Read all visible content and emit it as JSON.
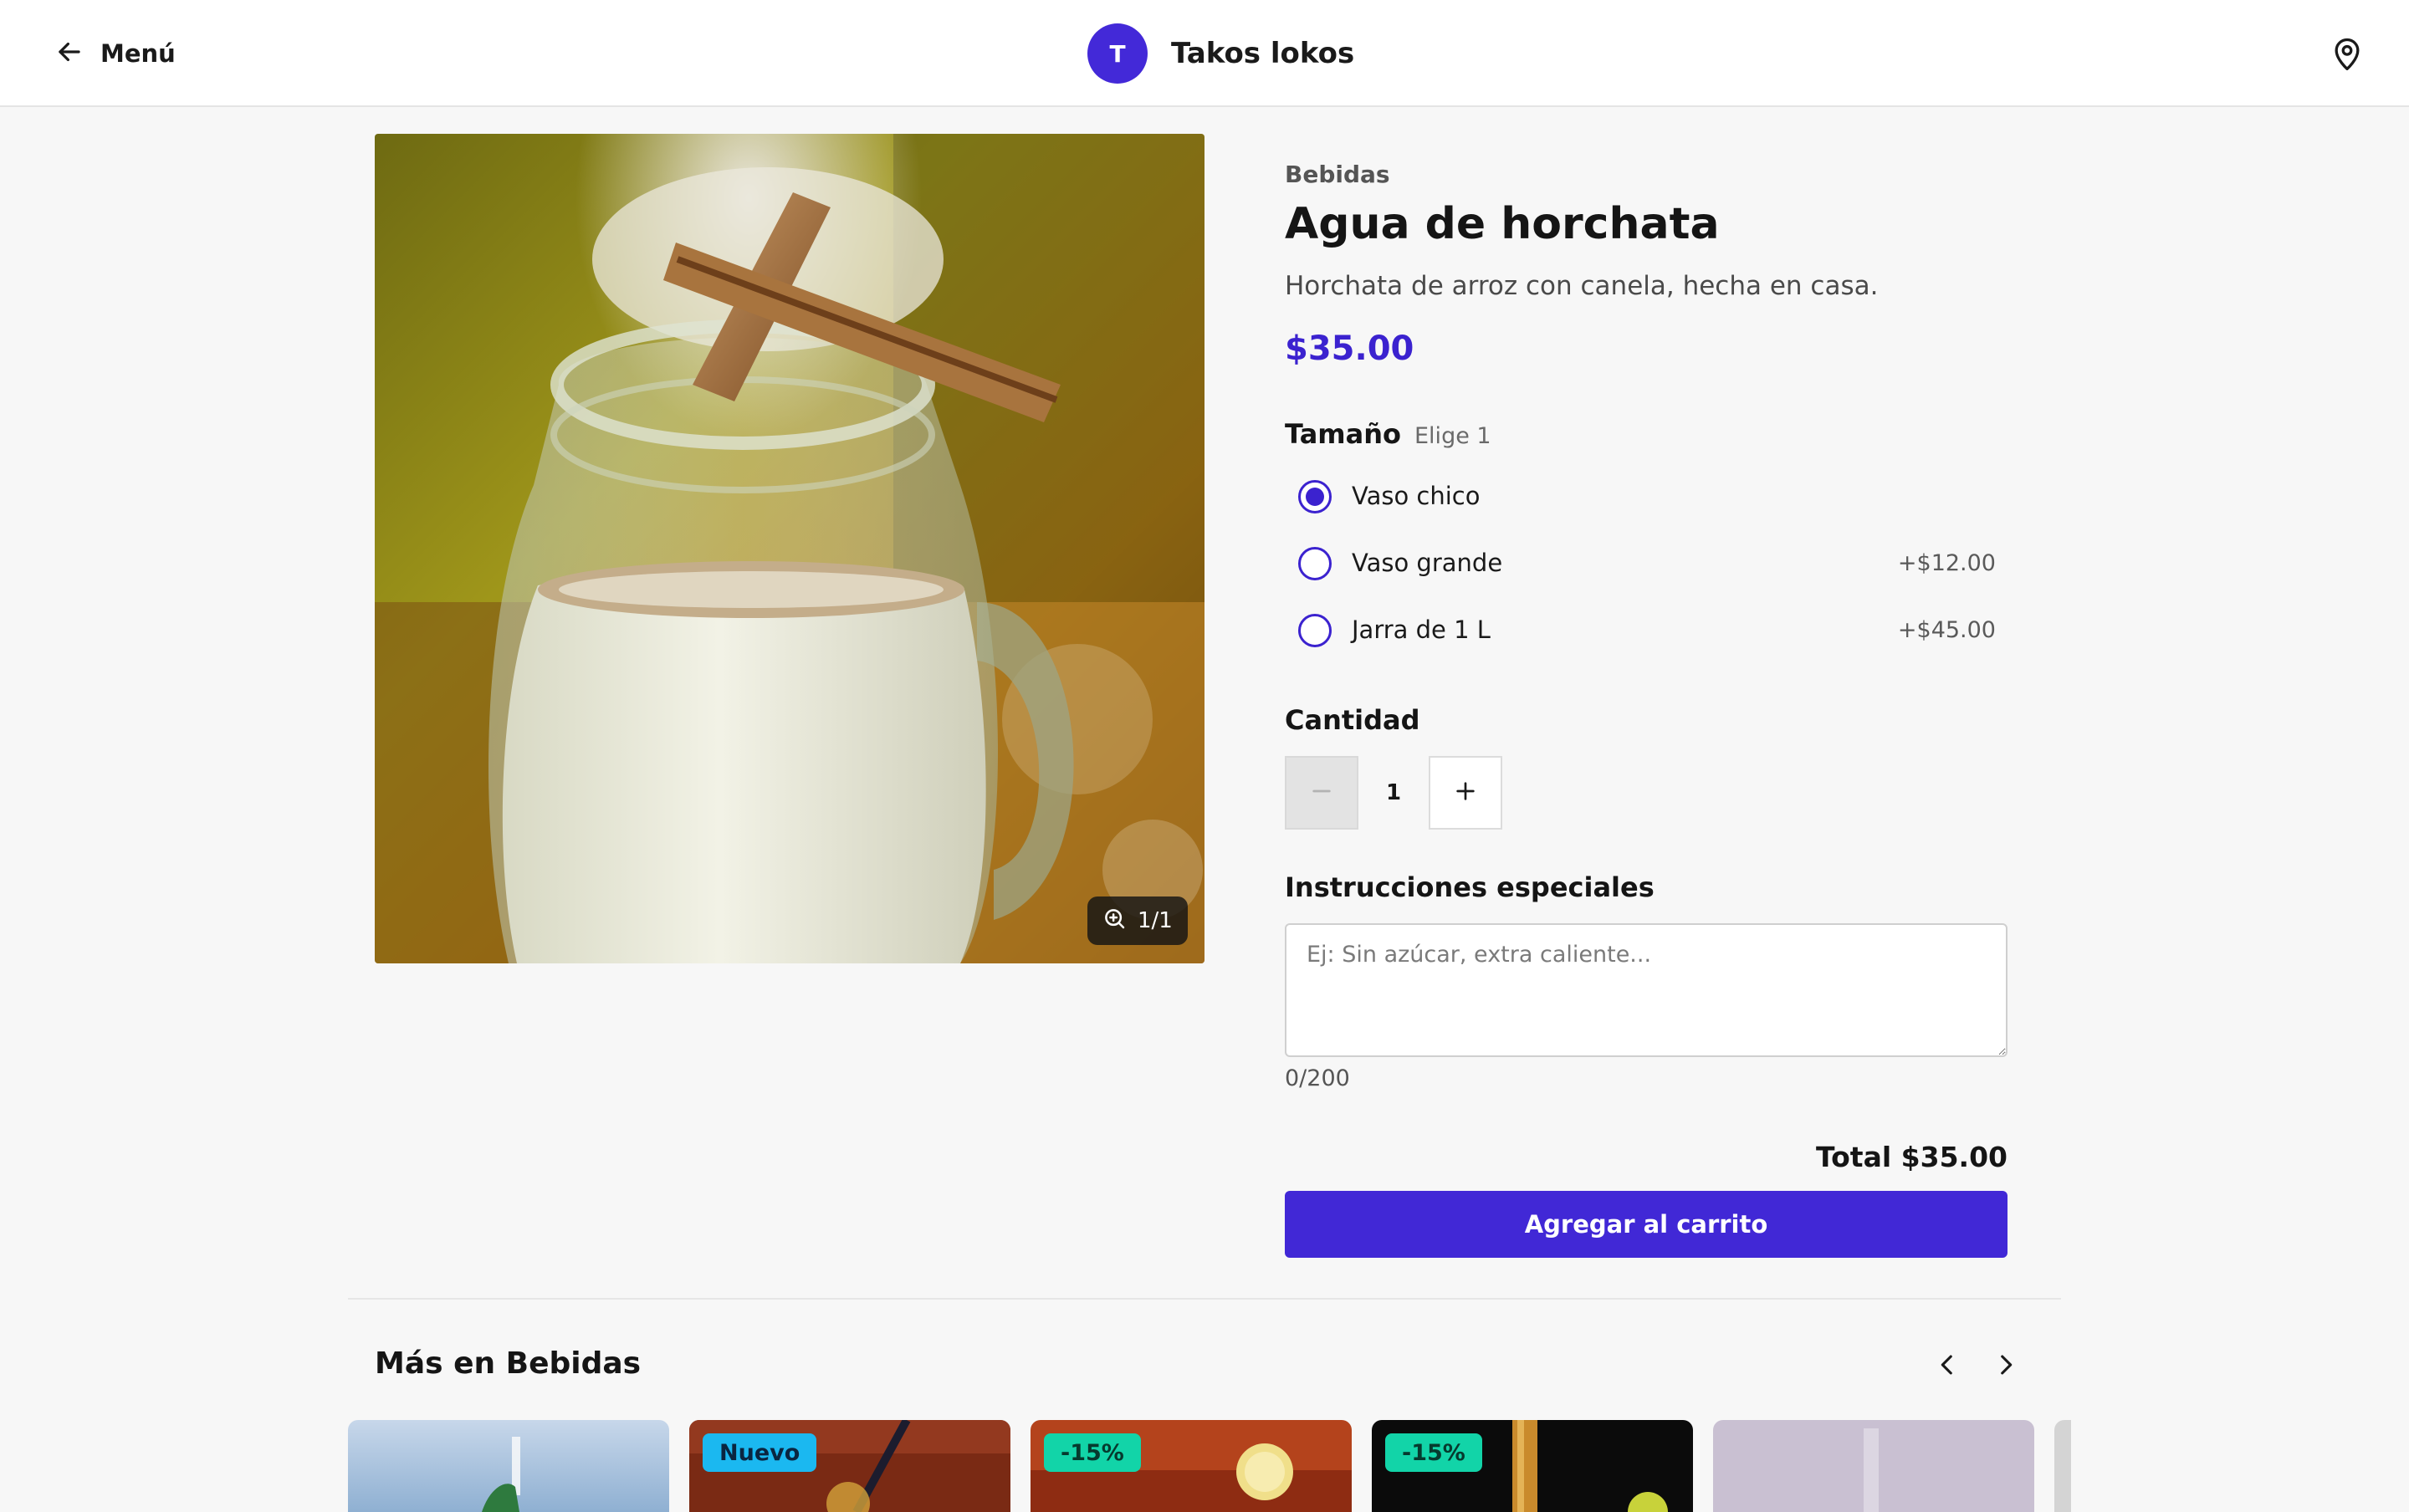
{
  "header": {
    "back_label": "Menú",
    "avatar_initial": "T",
    "restaurant_name": "Takos lokos"
  },
  "product": {
    "category": "Bebidas",
    "name": "Agua de horchata",
    "description": "Horchata de arroz con canela, hecha en casa.",
    "price": "$35.00",
    "image_counter": "1/1"
  },
  "size": {
    "title": "Tamaño",
    "hint": "Elige 1",
    "options": [
      {
        "label": "Vaso chico",
        "price": "",
        "selected": true
      },
      {
        "label": "Vaso grande",
        "price": "+$12.00",
        "selected": false
      },
      {
        "label": "Jarra de 1 L",
        "price": "+$45.00",
        "selected": false
      }
    ]
  },
  "quantity": {
    "title": "Cantidad",
    "value": "1"
  },
  "instructions": {
    "title": "Instrucciones especiales",
    "placeholder": "Ej: Sin azúcar, extra caliente...",
    "counter": "0/200"
  },
  "cart": {
    "total": "Total $35.00",
    "add_label": "Agregar al carrito"
  },
  "more": {
    "title": "Más en Bebidas",
    "cards": [
      {
        "badge": ""
      },
      {
        "badge": "Nuevo"
      },
      {
        "badge": "-15%"
      },
      {
        "badge": "-15%"
      },
      {
        "badge": ""
      }
    ]
  },
  "colors": {
    "accent": "#4128d6",
    "badge_new": "#1bb8f0",
    "badge_discount": "#12d4a8"
  },
  "icons": [
    "arrow-left-icon",
    "map-pin-icon",
    "zoom-in-icon",
    "minus-icon",
    "plus-icon",
    "chevron-left-icon",
    "chevron-right-icon"
  ]
}
